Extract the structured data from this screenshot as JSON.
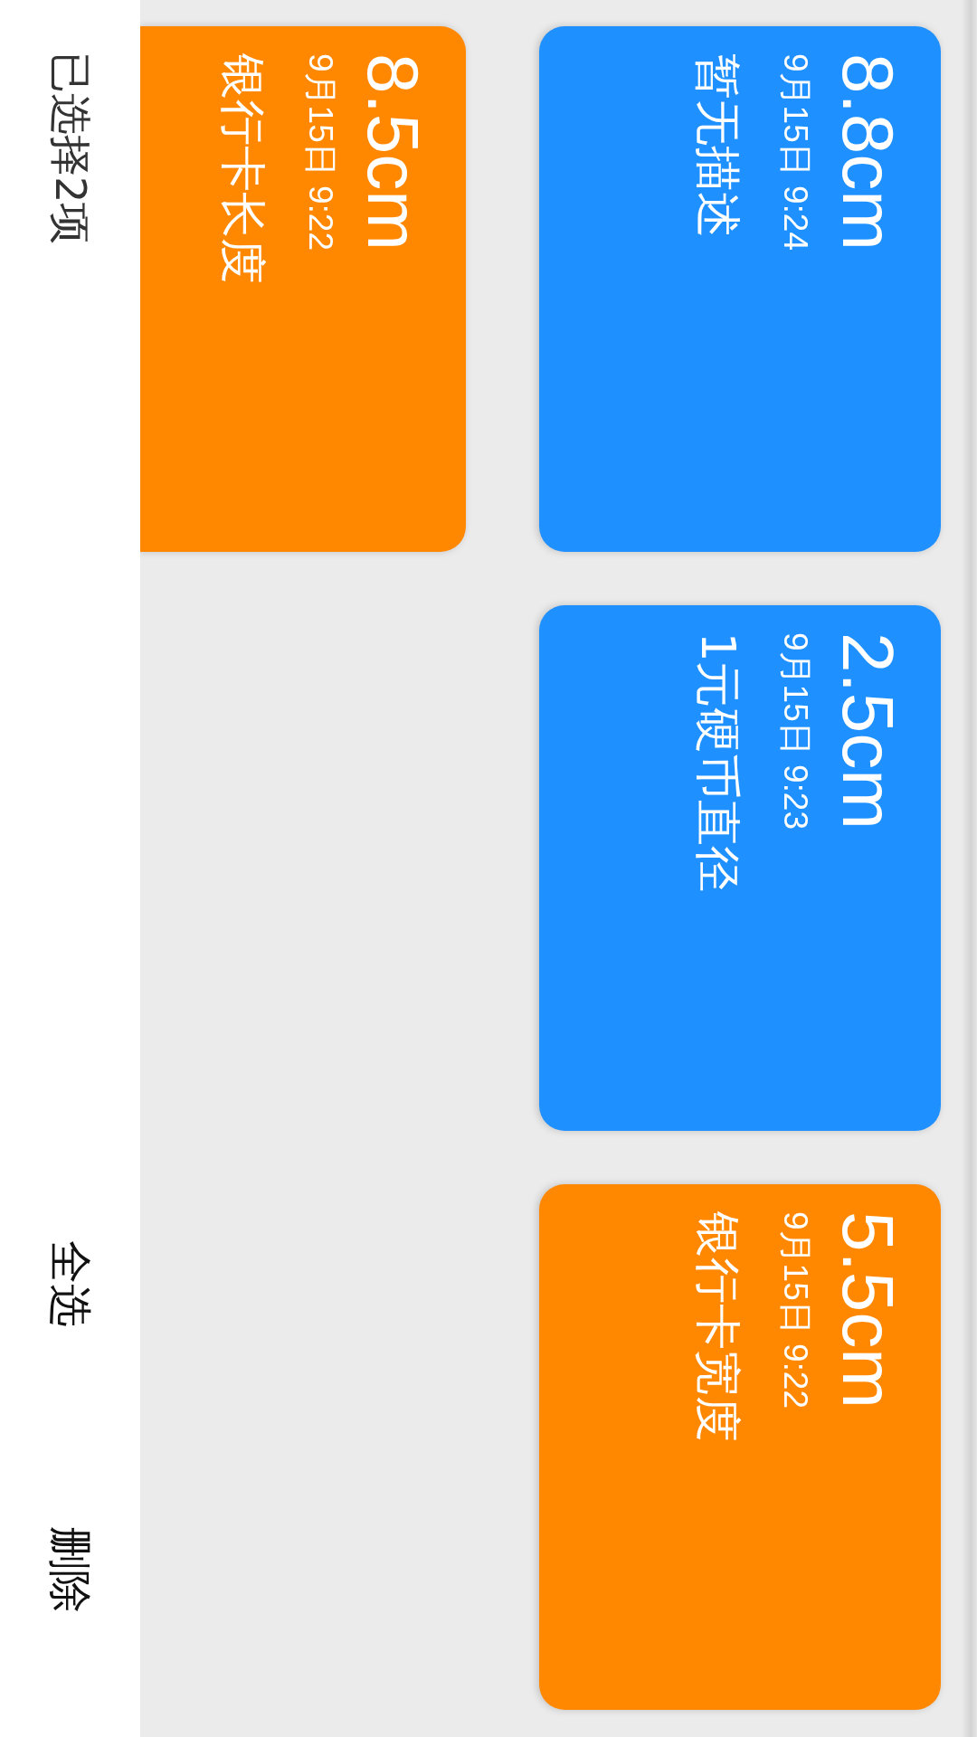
{
  "cards": [
    {
      "value": "8.8cm",
      "time": "9月15日 9:24",
      "description": "暂无描述",
      "selected": false
    },
    {
      "value": "2.5cm",
      "time": "9月15日 9:23",
      "description": "1元硬币直径",
      "selected": false
    },
    {
      "value": "5.5cm",
      "time": "9月15日 9:22",
      "description": "银行卡宽度",
      "selected": true
    },
    {
      "value": "8.5cm",
      "time": "9月15日 9:22",
      "description": "银行卡长度",
      "selected": true
    }
  ],
  "selection_bar": {
    "count_label": "已选择2项",
    "buttons": [
      "全选",
      "删除"
    ]
  }
}
